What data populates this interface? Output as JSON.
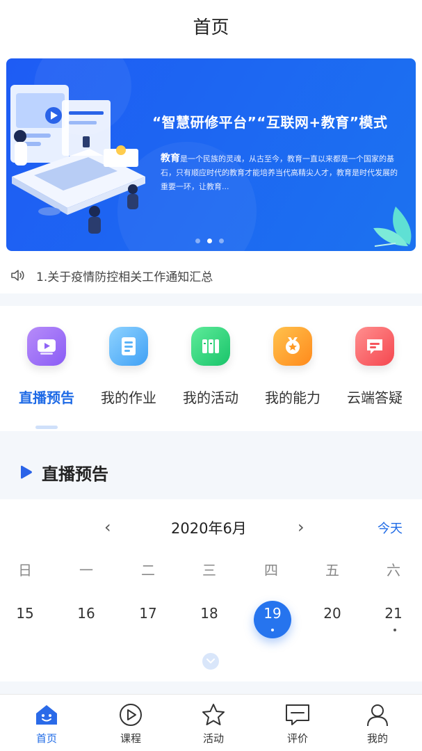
{
  "header": {
    "title": "首页"
  },
  "banner": {
    "headline": "“智慧研修平台”“互联网+教育”模式",
    "lead": "教育",
    "body": "是一个民族的灵魂，从古至今，教育一直以来都是一个国家的基石，只有顺应时代的教育才能培养当代高精尖人才，教育是时代发展的重要一环，让教育...",
    "slide_count": 3,
    "active_slide": 2
  },
  "notice": {
    "text": "1.关于疫情防控相关工作通知汇总",
    "icon": "speaker-icon"
  },
  "quick": {
    "items": [
      {
        "label": "直播预告",
        "icon": "live-video-icon",
        "active": true
      },
      {
        "label": "我的作业",
        "icon": "homework-icon",
        "active": false
      },
      {
        "label": "我的活动",
        "icon": "activity-icon",
        "active": false
      },
      {
        "label": "我的能力",
        "icon": "medal-icon",
        "active": false
      },
      {
        "label": "云端答疑",
        "icon": "chat-icon",
        "active": false
      }
    ]
  },
  "section": {
    "title": "直播预告"
  },
  "calendar": {
    "prev": "‹",
    "month": "2020年6月",
    "next": "›",
    "today": "今天",
    "weekdays": [
      "日",
      "一",
      "二",
      "三",
      "四",
      "五",
      "六"
    ],
    "dates": [
      "15",
      "16",
      "17",
      "18",
      "19",
      "20",
      "21"
    ],
    "selected": "19",
    "event_dates": [
      "19",
      "21"
    ]
  },
  "tabbar": {
    "items": [
      {
        "label": "首页",
        "icon": "home-icon",
        "active": true
      },
      {
        "label": "课程",
        "icon": "play-circle-icon",
        "active": false
      },
      {
        "label": "活动",
        "icon": "star-icon",
        "active": false
      },
      {
        "label": "评价",
        "icon": "comment-icon",
        "active": false
      },
      {
        "label": "我的",
        "icon": "user-icon",
        "active": false
      }
    ]
  },
  "colors": {
    "primary": "#1e6ae6",
    "banner": "#1e5cf4",
    "background": "#f4f7fb"
  }
}
